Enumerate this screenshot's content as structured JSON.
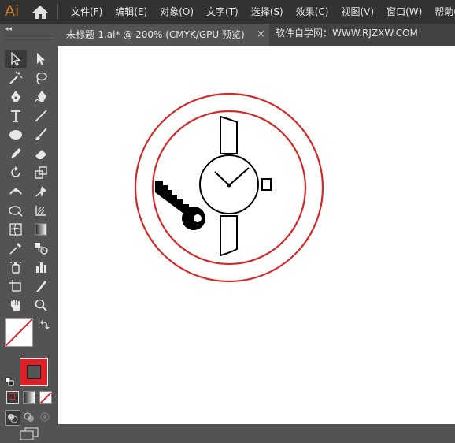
{
  "app": {
    "logo": "Ai"
  },
  "menu": [
    "文件(F)",
    "编辑(E)",
    "对象(O)",
    "文字(T)",
    "选择(S)",
    "效果(C)",
    "视图(V)",
    "窗口(W)",
    "帮助(H)"
  ],
  "tab": {
    "title": "未标题-1.ai* @ 200% (CMYK/GPU 预览)",
    "close": "×"
  },
  "watermark": "软件自学网：WWW.RJZXW.COM",
  "toolbar": {
    "collapse": "◂◂"
  },
  "colors": {
    "fill": "#ffffff",
    "stroke": "#e02028",
    "accent": "#ce7e2d",
    "ring": "#d42a2a"
  },
  "tools": [
    "selection-tool",
    "direct-selection-tool",
    "magic-wand-tool",
    "lasso-tool",
    "pen-tool",
    "curvature-tool",
    "type-tool",
    "line-segment-tool",
    "ellipse-tool",
    "paintbrush-tool",
    "pencil-tool",
    "eraser-tool",
    "rotate-tool",
    "scale-tool",
    "width-tool",
    "puppet-warp-tool",
    "free-transform-tool",
    "shape-builder-tool",
    "mesh-tool",
    "gradient-tool",
    "eyedropper-tool",
    "blend-tool",
    "symbol-sprayer-tool",
    "column-graph-tool",
    "artboard-tool",
    "slice-tool",
    "hand-tool",
    "zoom-tool"
  ]
}
